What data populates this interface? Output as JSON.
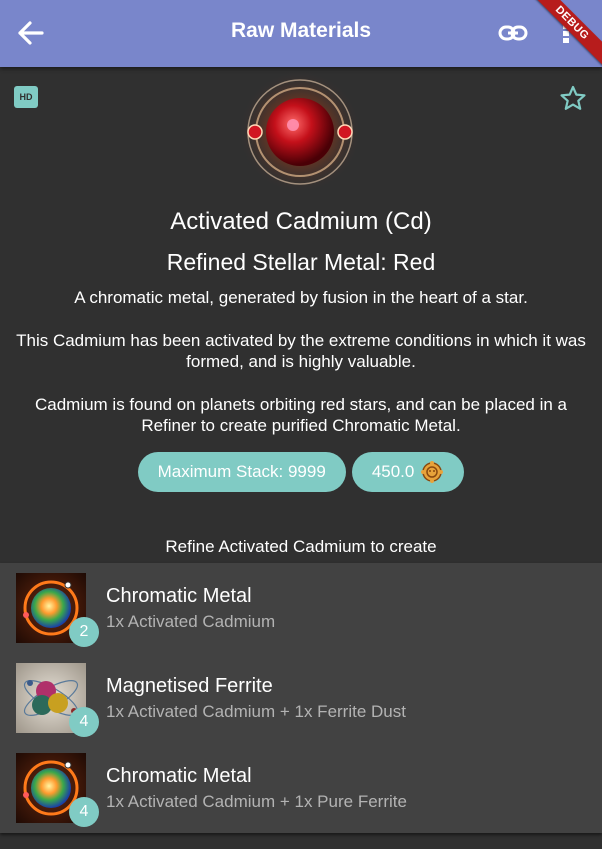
{
  "appbar": {
    "title": "Raw Materials",
    "back_icon": "arrow-left-icon",
    "link_icon": "link-icon",
    "more_icon": "more-vert-icon",
    "color": "#7986cb"
  },
  "debug_banner": "DEBUG",
  "hd_badge": "HD",
  "favourite_icon": "star-outline-icon",
  "item": {
    "name": "Activated Cadmium (Cd)",
    "group": "Refined Stellar Metal: Red",
    "description": [
      "A chromatic metal, generated by fusion in the heart of a star.",
      "This Cadmium has been activated by the extreme conditions in which it was formed, and is highly valuable.",
      "Cadmium is found on planets orbiting red stars, and can be placed in a Refiner to create purified Chromatic Metal."
    ]
  },
  "chips": {
    "max_stack": "Maximum Stack: 9999",
    "value": "450.0",
    "value_icon": "units-currency-icon"
  },
  "refine_heading": "Refine Activated Cadmium to create",
  "refine_rows": [
    {
      "name": "Chromatic Metal",
      "inputs": "1x Activated Cadmium",
      "qty": "2",
      "icon": "chromatic-metal-icon"
    },
    {
      "name": "Magnetised Ferrite",
      "inputs": "1x Activated Cadmium + 1x Ferrite Dust",
      "qty": "4",
      "icon": "magnetised-ferrite-icon"
    },
    {
      "name": "Chromatic Metal",
      "inputs": "1x Activated Cadmium + 1x Pure Ferrite",
      "qty": "4",
      "icon": "chromatic-metal-icon"
    }
  ],
  "accent_color": "#80cbc4",
  "background_color": "#303030"
}
